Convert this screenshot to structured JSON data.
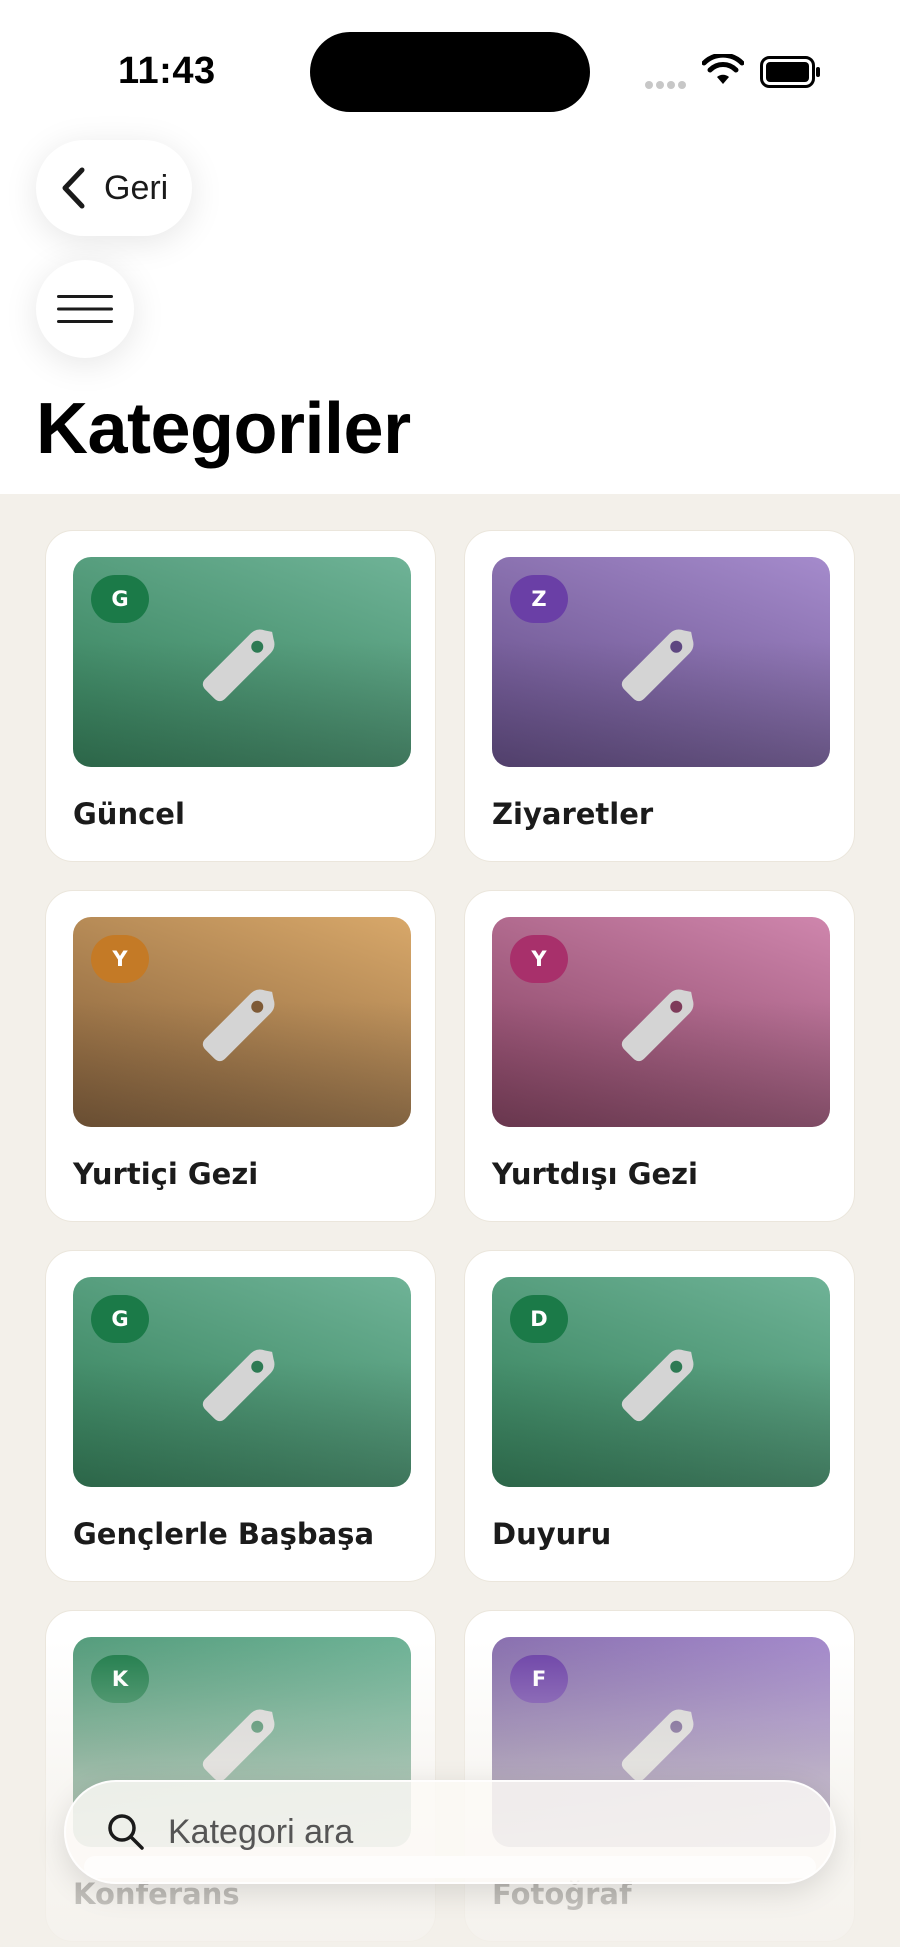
{
  "status_bar": {
    "time": "11:43"
  },
  "header": {
    "back_label": "Geri",
    "title": "Kategoriler"
  },
  "categories": [
    {
      "name": "Güncel",
      "letter": "G",
      "theme": "green"
    },
    {
      "name": "Ziyaretler",
      "letter": "Z",
      "theme": "purple"
    },
    {
      "name": "Yurtiçi Gezi",
      "letter": "Y",
      "theme": "orange"
    },
    {
      "name": "Yurtdışı Gezi",
      "letter": "Y",
      "theme": "pink"
    },
    {
      "name": "Gençlerle Başbaşa",
      "letter": "G",
      "theme": "green"
    },
    {
      "name": "Duyuru",
      "letter": "D",
      "theme": "green"
    },
    {
      "name": "Konferans",
      "letter": "K",
      "theme": "green"
    },
    {
      "name": "Fotoğraf",
      "letter": "F",
      "theme": "purple"
    }
  ],
  "themes": {
    "green": {
      "from": "#6fb397",
      "to": "#2d7a53",
      "badge": "#1b7a48"
    },
    "purple": {
      "from": "#a58bcc",
      "to": "#5e4781",
      "badge": "#6a3fa6"
    },
    "orange": {
      "from": "#d8a86a",
      "to": "#7e5a36",
      "badge": "#c47a26"
    },
    "pink": {
      "from": "#cf86ad",
      "to": "#7e3b5a",
      "badge": "#a8306b"
    }
  },
  "search": {
    "placeholder": "Kategori ara",
    "value": ""
  },
  "icons": {
    "back": "chevron-left-icon",
    "menu": "hamburger-menu-icon",
    "tag": "tag-icon",
    "search": "search-icon"
  }
}
